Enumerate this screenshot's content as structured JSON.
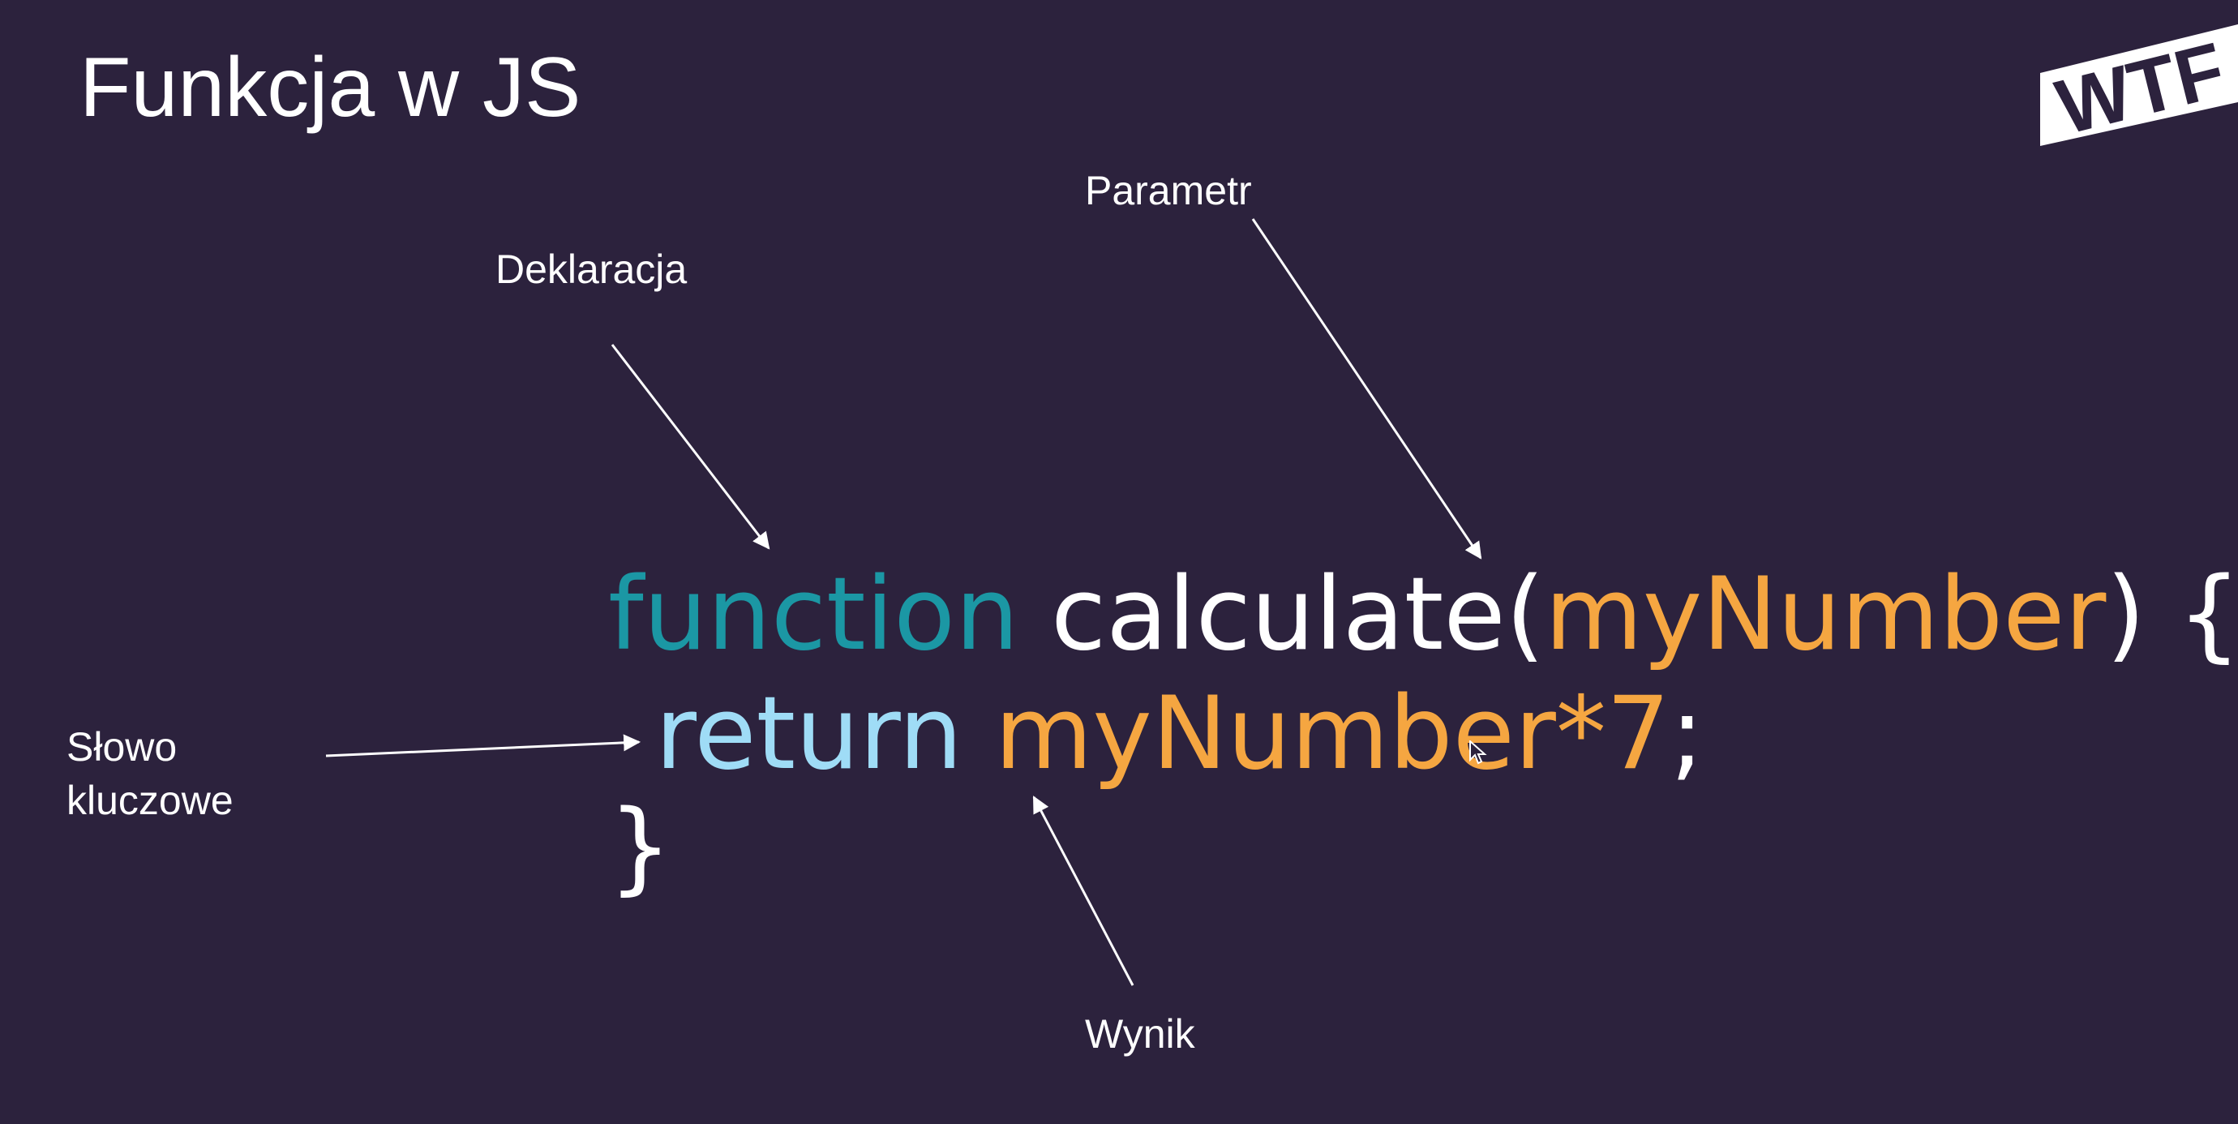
{
  "slide": {
    "title": "Funkcja w JS"
  },
  "logo": {
    "text": "WTF",
    "colors": {
      "fill": "#ffffff",
      "text": "#2c223d"
    }
  },
  "annotations": {
    "deklaracja": "Deklaracja",
    "parametr": "Parametr",
    "slowo_line1": "Słowo",
    "slowo_line2": "kluczowe",
    "wynik": "Wynik"
  },
  "code": {
    "line1": {
      "keyword": "function",
      "space": " ",
      "name": "calculate(",
      "param": "myNumber",
      "close": ") {"
    },
    "line2": {
      "keyword": "return",
      "space": " ",
      "expr": "myNumber*7",
      "end": ";"
    },
    "line3": {
      "brace": "}"
    }
  },
  "colors": {
    "background": "#2c223d",
    "keyword_function": "#1b97a4",
    "keyword_return": "#9fdcf6",
    "identifier": "#f5a641",
    "text": "#ffffff"
  }
}
